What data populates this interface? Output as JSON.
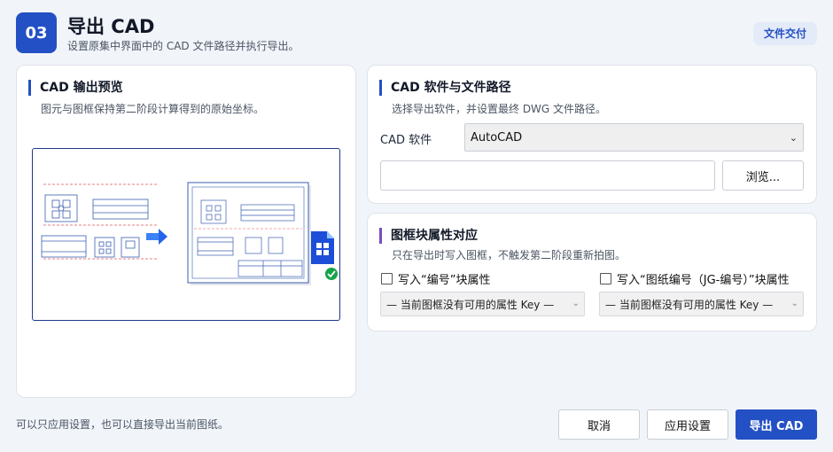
{
  "header": {
    "step": "03",
    "title": "导出 CAD",
    "subtitle": "设置原集中界面中的 CAD 文件路径并执行导出。",
    "tag": "文件交付"
  },
  "preview": {
    "title": "CAD 输出预览",
    "desc": "图元与图框保持第二阶段计算得到的原始坐标。"
  },
  "software": {
    "title": "CAD 软件与文件路径",
    "desc": "选择导出软件，并设置最终 DWG 文件路径。",
    "label": "CAD 软件",
    "selected": "AutoCAD",
    "path_value": "",
    "browse_label": "浏览..."
  },
  "attributes": {
    "title": "图框块属性对应",
    "desc": "只在导出时写入图框，不触发第二阶段重新拍图。",
    "check1_label": "写入“编号”块属性",
    "check2_label": "写入“图纸编号（JG-编号）”块属性",
    "select1_value": "— 当前图框没有可用的属性 Key —",
    "select2_value": "— 当前图框没有可用的属性 Key —"
  },
  "footer": {
    "note": "可以只应用设置，也可以直接导出当前图纸。",
    "cancel_label": "取消",
    "apply_label": "应用设置",
    "export_label": "导出 CAD"
  },
  "colors": {
    "accent": "#2350c4",
    "accent_purple": "#7c4dbe",
    "background": "#f1f4f9"
  },
  "icons": {
    "arrow": "arrow-right-icon",
    "dwg_file": "dwg-file-icon",
    "check": "check-circle-icon",
    "dropdown": "chevron-down-icon"
  }
}
